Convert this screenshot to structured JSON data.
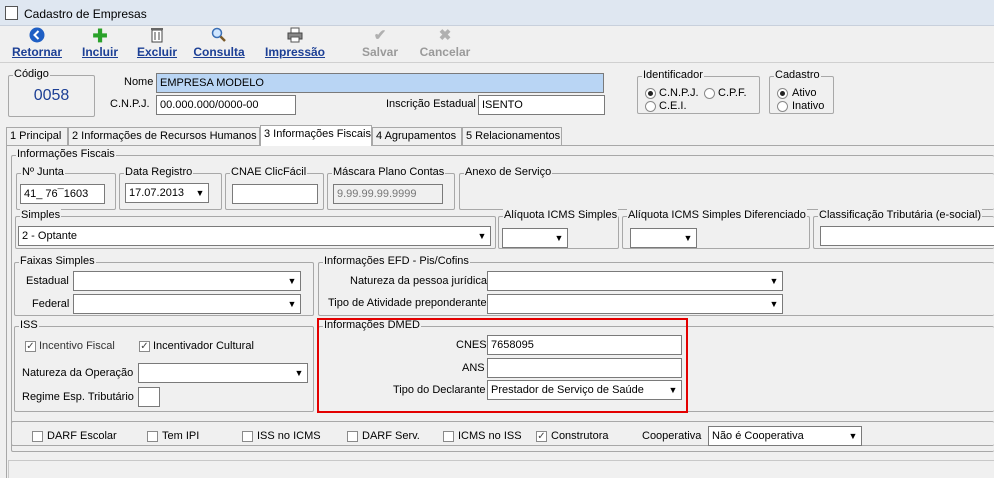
{
  "window": {
    "title": "Cadastro de Empresas"
  },
  "toolbar": {
    "retornar": "Retornar",
    "incluir": "Incluir",
    "excluir": "Excluir",
    "consulta": "Consulta",
    "impressao": "Impressão",
    "salvar": "Salvar",
    "cancelar": "Cancelar"
  },
  "header": {
    "codigo_label": "Código",
    "codigo_value": "0058",
    "nome_label": "Nome",
    "nome_value": "EMPRESA MODELO",
    "cnpj_label": "C.N.P.J.",
    "cnpj_value": "00.000.000/0000-00",
    "ie_label": "Inscrição Estadual",
    "ie_value": "ISENTO",
    "identificador_label": "Identificador",
    "id_cnpj": "C.N.P.J.",
    "id_cpf": "C.P.F.",
    "id_cei": "C.E.I.",
    "cadastro_label": "Cadastro",
    "ativo": "Ativo",
    "inativo": "Inativo"
  },
  "tabs": [
    {
      "label": "1 Principal"
    },
    {
      "label": "2 Informações de Recursos Humanos"
    },
    {
      "label": "3 Informações Fiscais"
    },
    {
      "label": "4 Agrupamentos"
    },
    {
      "label": "5 Relacionamentos"
    }
  ],
  "fiscal": {
    "group_label": "Informações Fiscais",
    "junta_label": "Nº Junta",
    "junta_value": "41_ 76¯1603",
    "data_registro_label": "Data Registro",
    "data_registro_value": "17.07.2013",
    "cnae_label": "CNAE ClicFácil",
    "cnae_value": "",
    "mascara_label": "Máscara Plano Contas",
    "mascara_value": "9.99.99.99.9999",
    "anexo_label": "Anexo de Serviço",
    "simples_label": "Simples",
    "simples_value": "2 - Optante",
    "aliq_icms_label": "Alíquota ICMS Simples",
    "aliq_icms_dif_label": "Alíquota ICMS Simples Diferenciado",
    "class_trib_label": "Classificação Tributária (e-social)",
    "faixas_label": "Faixas Simples",
    "estadual_label": "Estadual",
    "federal_label": "Federal",
    "efd_label": "Informações EFD - Pis/Cofins",
    "natureza_pj_label": "Natureza da pessoa jurídica",
    "tipo_atividade_label": "Tipo de Atividade preponderante",
    "iss_label": "ISS",
    "incentivo_fiscal": "Incentivo Fiscal",
    "incentivador_cultural": "Incentivador Cultural",
    "natureza_operacao_label": "Natureza da Operação",
    "regime_label": "Regime Esp. Tributário",
    "dmed_label": "Informações DMED",
    "cnes_label": "CNES",
    "cnes_value": "7658095",
    "ans_label": "ANS",
    "ans_value": "",
    "tipo_declarante_label": "Tipo do Declarante",
    "tipo_declarante_value": "Prestador de Serviço de Saúde"
  },
  "bottom": {
    "darf_escolar": "DARF Escolar",
    "tem_ipi": "Tem IPI",
    "iss_icms": "ISS no ICMS",
    "darf_serv": "DARF Serv.",
    "icms_iss": "ICMS no ISS",
    "construtora": "Construtora",
    "cooperativa_label": "Cooperativa",
    "cooperativa_value": "Não é Cooperativa"
  }
}
